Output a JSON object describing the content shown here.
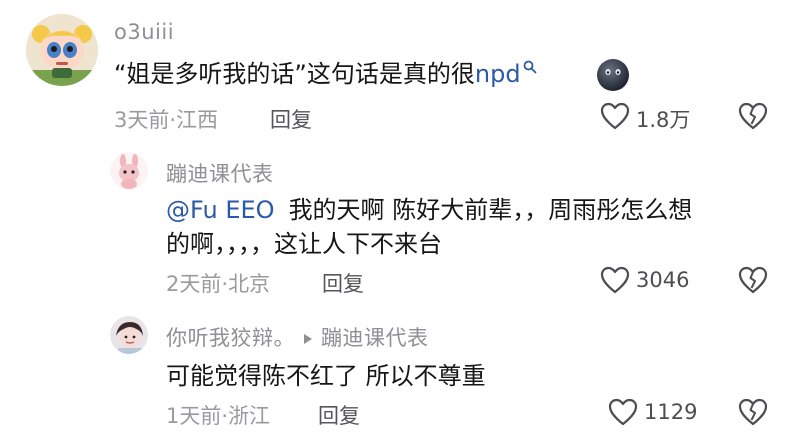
{
  "comments": [
    {
      "username": "o3uiii",
      "text_before": "“姐是多听我的话”这句话是真的很",
      "search_keyword": "npd",
      "time": "3天前",
      "location": "江西",
      "reply_label": "回复",
      "likes": "1.8万"
    },
    {
      "username": "蹦迪课代表",
      "mention": "@Fu EEO",
      "line1": "我的天啊 陈好大前辈，，周雨彤怎么想",
      "line2": "的啊，，，，这让人下不来台",
      "time": "2天前",
      "location": "北京",
      "reply_label": "回复",
      "likes": "3046"
    },
    {
      "username": "你听我狡辩。",
      "reply_to": "蹦迪课代表",
      "text": "可能觉得陈不红了 所以不尊重",
      "time": "1天前",
      "location": "浙江",
      "reply_label": "回复",
      "likes": "1129"
    }
  ],
  "separator": "·",
  "icons": [
    "heart-icon",
    "dislike-heart-icon",
    "search-icon",
    "emoji-icon",
    "play-arrow-icon"
  ]
}
